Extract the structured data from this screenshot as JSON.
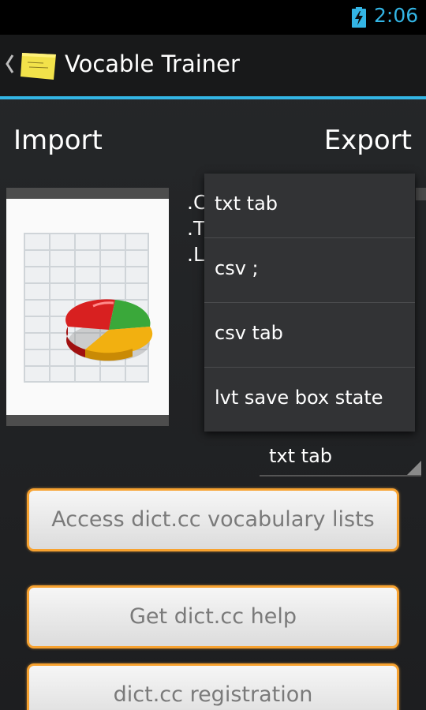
{
  "status_bar": {
    "time": "2:06",
    "battery_icon": "battery-charging-icon"
  },
  "action_bar": {
    "title": "Vocable Trainer",
    "up_icon": "chevron-left-icon",
    "logo_icon": "sticky-note-logo-icon"
  },
  "sections": {
    "import_label": "Import",
    "export_label": "Export"
  },
  "import_formats": [
    ".C",
    ".T",
    ".L"
  ],
  "export_spinner": {
    "selected": "txt tab",
    "options": [
      "txt tab",
      "csv ;",
      "csv tab",
      "lvt save box state"
    ]
  },
  "buttons": {
    "access_lists": "Access dict.cc vocabulary lists",
    "get_help": "Get dict.cc help",
    "registration": "dict.cc registration"
  },
  "colors": {
    "accent": "#33b5e5",
    "button_border": "#f7a230",
    "button_text": "#7a7a7a",
    "background": "#1f2022"
  }
}
